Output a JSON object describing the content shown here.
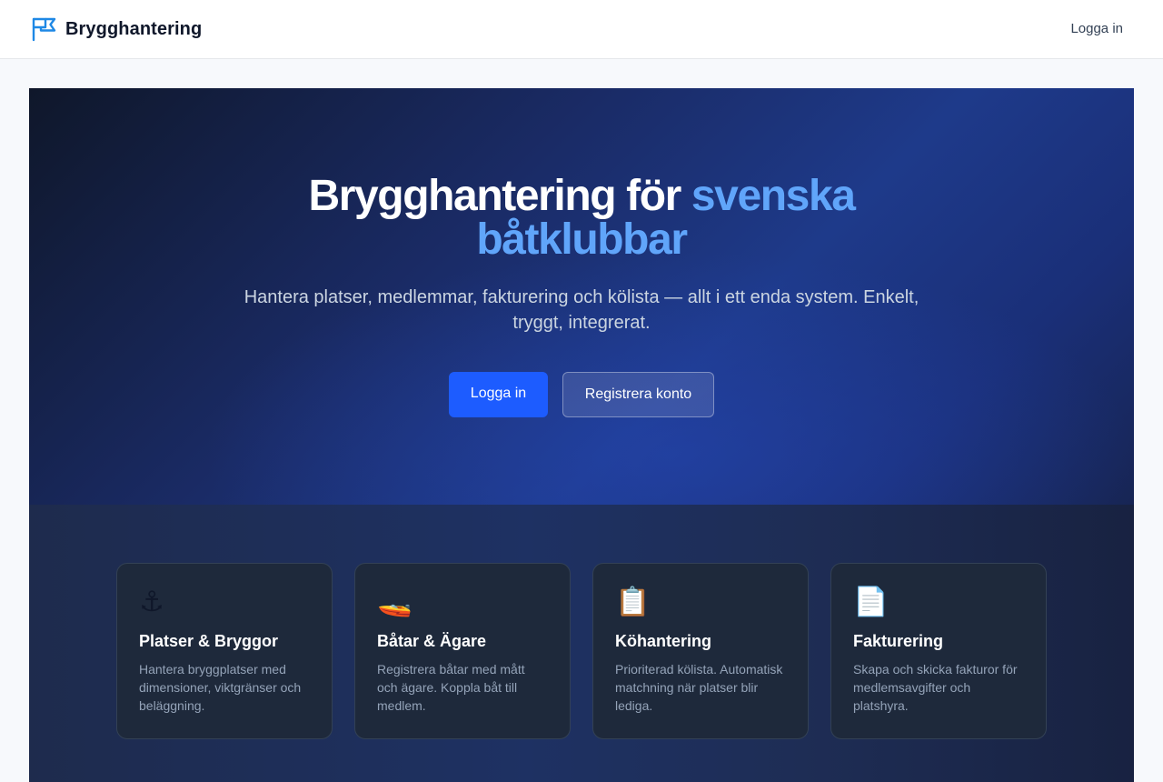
{
  "colors": {
    "brand_icon": "#1e88e5",
    "primary_button": "#1d5cff",
    "title_accent": "#60a5fa",
    "hero_background": "#1e3a8a",
    "card_background": "#1e293b"
  },
  "navbar": {
    "brand_name": "Brygghantering",
    "brand_icon": "flag-icon",
    "login_link": "Logga in"
  },
  "hero": {
    "title_main": "Brygghantering för ",
    "title_accent": "svenska båtklubbar",
    "subtitle": "Hantera platser, medlemmar, fakturering och kölista — allt i ett enda system. Enkelt, tryggt, integrerat.",
    "primary_button": "Logga in",
    "secondary_button": "Registrera konto"
  },
  "features": {
    "cards": [
      {
        "icon": "anchor-icon",
        "glyph": "⚓",
        "title": "Platser & Bryggor",
        "description": "Hantera bryggplatser med dimensioner, viktgränser och beläggning."
      },
      {
        "icon": "speedboat-icon",
        "glyph": "🚤",
        "title": "Båtar & Ägare",
        "description": "Registrera båtar med mått och ägare. Koppla båt till medlem."
      },
      {
        "icon": "clipboard-icon",
        "glyph": "📋",
        "title": "Köhantering",
        "description": "Prioriterad kölista. Automatisk matchning när platser blir lediga."
      },
      {
        "icon": "document-icon",
        "glyph": "📄",
        "title": "Fakturering",
        "description": "Skapa och skicka fakturor för medlemsavgifter och platshyra."
      }
    ]
  }
}
